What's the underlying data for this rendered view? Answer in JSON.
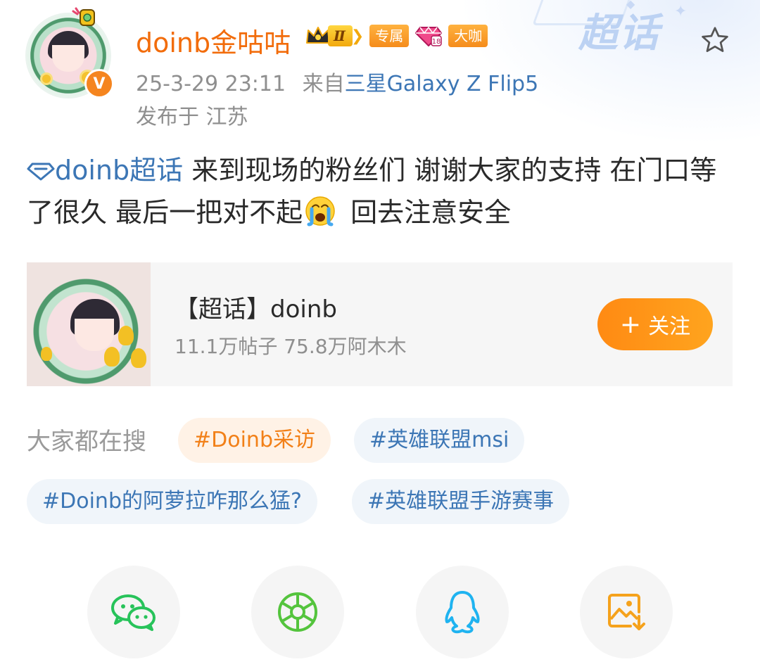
{
  "header": {
    "watermark_text": "超话",
    "username": "doinb金咕咕",
    "level_badge": "Ⅱ",
    "tag_exclusive": "专属",
    "tag_bigshot": "大咖",
    "timestamp": "25-3-29 23:11",
    "source_prefix": "来自",
    "device": "三星Galaxy Z Flip5",
    "location": "发布于 江苏"
  },
  "post": {
    "topic_link": "doinb超话",
    "text_part1": " 来到现场的粉丝们 谢谢大家的支持 在门口等了很久 最后一把对不起",
    "text_part2": " 回去注意安全"
  },
  "topic_card": {
    "title": "【超话】doinb",
    "stats": "11.1万帖子 75.8万阿木木",
    "follow_label": "关注",
    "follow_plus": "+"
  },
  "hot_search": {
    "label": "大家都在搜",
    "chips": [
      "#Doinb采访",
      "#英雄联盟msi",
      "#Doinb的阿萝拉咋那么猛?",
      "#英雄联盟手游赛事"
    ]
  },
  "share_row": {
    "icons": [
      "wechat-icon",
      "moments-icon",
      "qq-icon",
      "save-image-icon"
    ]
  },
  "colors": {
    "username_orange": "#f26c0b",
    "link_blue": "#3c76b5",
    "follow_orange": "#ff8a13",
    "meta_gray": "#8f8f8f",
    "wechat_green": "#27c35a",
    "qq_blue": "#1fb3f0",
    "save_orange": "#f5a21c"
  }
}
